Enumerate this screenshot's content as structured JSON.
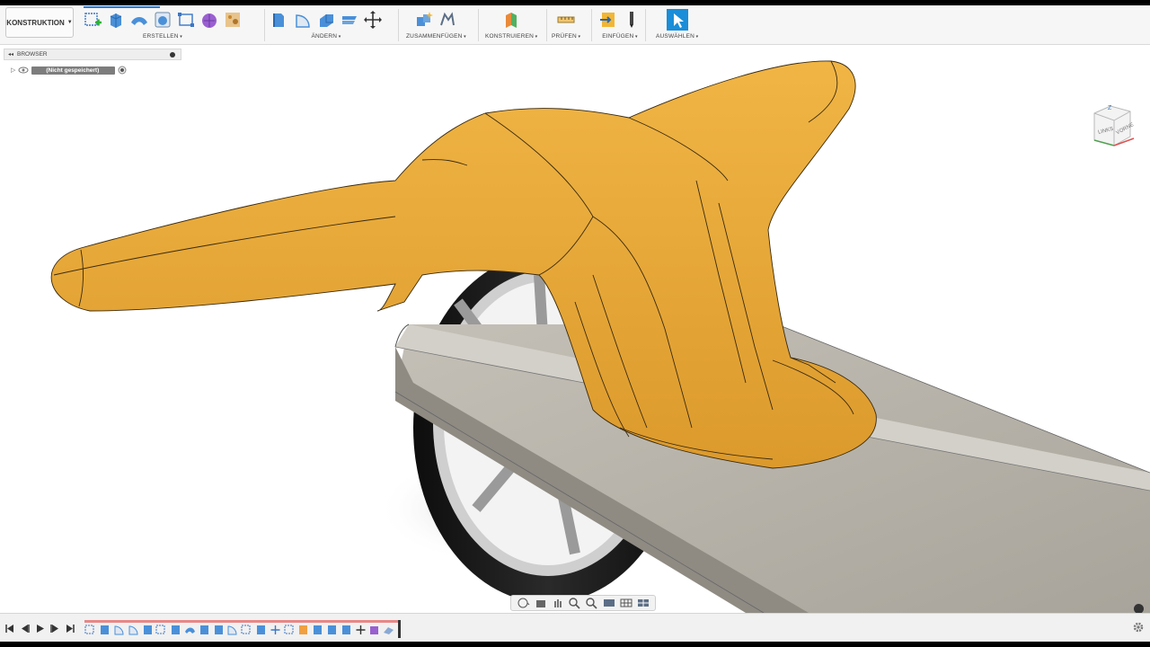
{
  "toolbar": {
    "workspace": "KONSTRUKTION",
    "groups": {
      "erstellen": "ERSTELLEN",
      "aendern": "ÄNDERN",
      "zusammenfuegen": "ZUSAMMENFÜGEN",
      "konstruieren": "KONSTRUIEREN",
      "pruefen": "PRÜFEN",
      "einfuegen": "EINFÜGEN",
      "auswaehlen": "AUSWÄHLEN"
    }
  },
  "browser": {
    "title": "BROWSER",
    "document": "(Nicht gespeichert)"
  },
  "viewcube": {
    "left_face": "LINKS",
    "front_face": "VORNE",
    "axis": "Z"
  },
  "colors": {
    "accent": "#2a7bd6",
    "body_orange": "#e8a83a",
    "deck_gray": "#b3afa6",
    "timeline_bar": "#e88787"
  },
  "icons": {
    "toolbar": [
      "create-sketch-icon",
      "extrude-icon",
      "sweep-icon",
      "revolve-icon",
      "rectangle-icon",
      "form-icon",
      "decal-icon",
      "press-pull-icon",
      "fillet-icon",
      "shell-icon",
      "split-icon",
      "move-icon",
      "new-component-icon",
      "joint-icon",
      "plane-icon",
      "measure-icon",
      "insert-icon",
      "sketch-pencil-icon",
      "select-icon"
    ],
    "navbar": [
      "orbit-icon",
      "home-icon",
      "pan-icon",
      "zoom-icon",
      "fit-icon",
      "display-icon",
      "grid-icon",
      "viewports-icon"
    ],
    "timeline_controls": [
      "first-icon",
      "prev-icon",
      "play-icon",
      "next-icon",
      "last-icon"
    ]
  }
}
